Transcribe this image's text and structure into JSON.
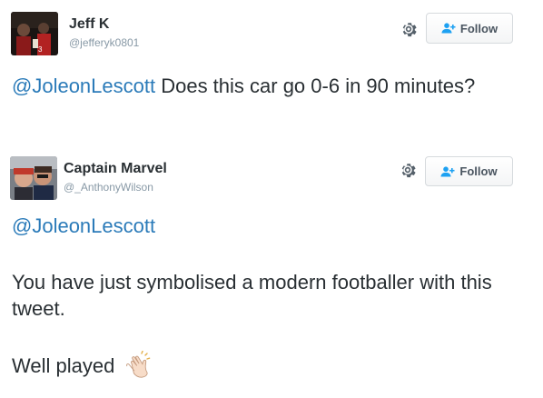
{
  "tweets": [
    {
      "display_name": "Jeff K",
      "handle": "@jefferyk0801",
      "follow_label": "Follow",
      "mention": "@JoleonLescott",
      "text": " Does this car go 0-6 in 90 minutes?"
    },
    {
      "display_name": "Captain Marvel",
      "handle": "@_AnthonyWilson",
      "follow_label": "Follow",
      "mention": "@JoleonLescott",
      "text": "You have just symbolised a modern footballer with this tweet.",
      "closing": "Well played"
    }
  ],
  "icons": {
    "settings": "gear-icon",
    "follow": "person-plus-icon",
    "clap": "clapping-hands-icon"
  },
  "colors": {
    "mention": "#2b7bb9",
    "text": "#292f33",
    "muted": "#8899a6"
  }
}
